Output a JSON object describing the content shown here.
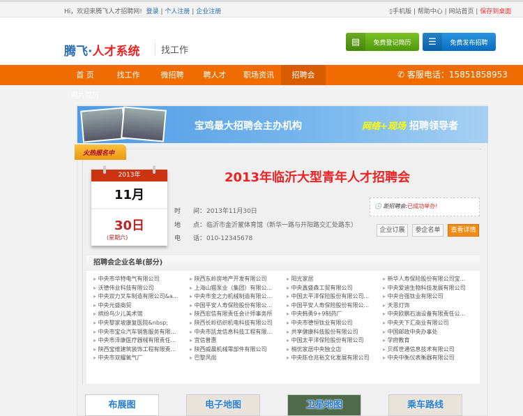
{
  "topbar": {
    "welcome": "Hi，欢迎来腾飞人才招聘网!",
    "login": "登录",
    "personal_register": "个人注册",
    "company_register": "企业注册",
    "mobile": "手机版",
    "help": "帮助中心",
    "home": "网站首页",
    "save_desktop": "保存到桌面"
  },
  "header": {
    "logo_blue": "腾飞·",
    "logo_red": "人才系统",
    "subtitle": "找工作",
    "btn_resume": "免费登记简历",
    "btn_post": "免费发布招聘"
  },
  "nav": {
    "items": [
      "首 页",
      "找工作",
      "微招聘",
      "聘人才",
      "职场资讯",
      "招聘会"
    ],
    "active": "招聘会",
    "phone": "客服电话：15851858953"
  },
  "breadcrumb": "照片简历",
  "banner": {
    "text1": "宝鸡最大招聘会主办机构",
    "text2": "网络+现场",
    "text3": "招聘领导者"
  },
  "fair": {
    "ribbon": "火热报名中",
    "year": "2013年",
    "month": "11月",
    "day": "30日",
    "weekday": "(星期六)",
    "title": "2013年临沂大型青年人才招聘会",
    "time_label": "时　　间：",
    "time": "2013年11月30日",
    "place_label": "地　　点：",
    "place": "临沂市金沂蒙体育馆（新华一路与开阳路交汇处路东）",
    "phone_label": "电　　话：",
    "phone": "010-12345678",
    "notice_label": "距招聘会:",
    "notice_status": "已成功举办!",
    "btn_booth": "企业订展",
    "btn_list": "参企名单",
    "btn_detail": "查看详情"
  },
  "companies": {
    "title": "招聘会企业名单(部分)",
    "columns": [
      [
        "中央市华特电气有限公司",
        "沃德伟业科技有限公司",
        "中央双力叉车制造有限公司&a...",
        "中央元盛商贸",
        "缤纷鸟少儿美术馆",
        "中央黎家坡康复医院&nbsp;",
        "中央市宝众汽车销售服务有限...",
        "中央市泽康医疗器械有限责任...",
        "陕西宝维建筑装饰工程有限责...",
        "中央市双耀氧气厂"
      ],
      [
        "陕西东岭房地产开发有限公司",
        "上海山猫泵业（集团）有限公...",
        "中央市金之力机械制造有限公...",
        "中国平安人寿保险股份有限公...",
        "陕西宏信有限责任会计师事务所",
        "陕西长岭纺织机电科技有限公司",
        "中央市凯龙信息科技工程有限...",
        "宜信普惠",
        "陕西威晨机械零部件有限公司",
        "巴黎风尚"
      ],
      [
        "阳光家居",
        "中央鑫盛森工贸有限公司",
        "中国太平洋保险股份有限公司...",
        "中国平安人寿保险股份有限公...",
        "中央韩勇9+9制药厂",
        "中央市德恒钛业有限公司",
        "共享健康科技股份有限公司",
        "中国太平洋保险股份有限公司",
        "梢优家居中央独立店",
        "中央陈仓兆裕文化发展有限公司"
      ],
      [
        "新华人寿保险股份有限公司宝...",
        "中央爱迪生物科技发展有限公司",
        "中央合强钛业有限公司",
        "天恩灯饰",
        "中央欧鹏石油设备有限责任公...",
        "中央天下汇商业有限公司",
        "中国邮政中央办事处",
        "学府教育",
        "贝辉世通信息技术有限公司",
        "中央中衡仪表衡器有限公司"
      ]
    ]
  },
  "maps": [
    "布展图",
    "电子地图",
    "卫星地图",
    "乘车路线"
  ]
}
